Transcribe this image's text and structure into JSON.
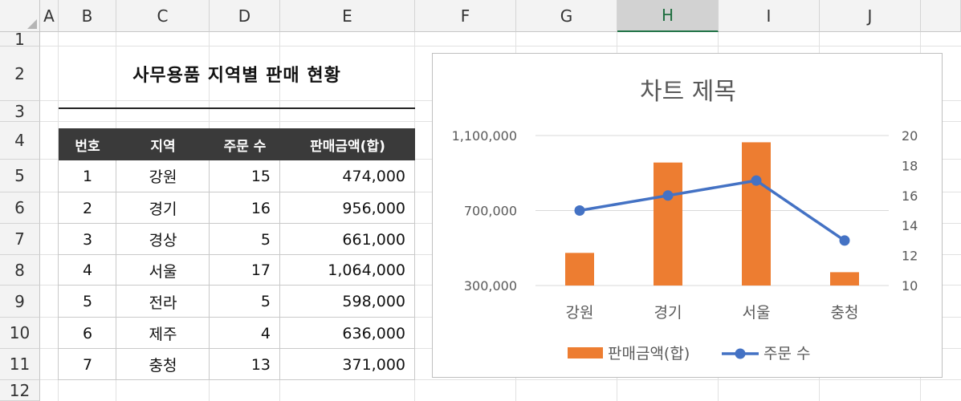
{
  "columns": [
    "A",
    "B",
    "C",
    "D",
    "E",
    "F",
    "G",
    "H",
    "I",
    "J"
  ],
  "rows": [
    "1",
    "2",
    "3",
    "4",
    "5",
    "6",
    "7",
    "8",
    "9",
    "10",
    "11",
    "12"
  ],
  "selected_column": "H",
  "table": {
    "title": "사무용품 지역별 판매 현황",
    "headers": [
      "번호",
      "지역",
      "주문 수",
      "판매금액(합)"
    ],
    "rows": [
      [
        "1",
        "강원",
        "15",
        "474,000"
      ],
      [
        "2",
        "경기",
        "16",
        "956,000"
      ],
      [
        "3",
        "경상",
        "5",
        "661,000"
      ],
      [
        "4",
        "서울",
        "17",
        "1,064,000"
      ],
      [
        "5",
        "전라",
        "5",
        "598,000"
      ],
      [
        "6",
        "제주",
        "4",
        "636,000"
      ],
      [
        "7",
        "충청",
        "13",
        "371,000"
      ]
    ]
  },
  "colors": {
    "bar": "#ED7D31",
    "line": "#4472C4",
    "header_bg": "#3A3A3A"
  },
  "chart_data": {
    "type": "bar",
    "title": "차트 제목",
    "categories": [
      "강원",
      "경기",
      "서울",
      "충청"
    ],
    "series": [
      {
        "name": "판매금액(합)",
        "kind": "bar",
        "axis": "left",
        "values": [
          474000,
          956000,
          1064000,
          371000
        ]
      },
      {
        "name": "주문 수",
        "kind": "line",
        "axis": "right",
        "values": [
          15,
          16,
          17,
          13
        ]
      }
    ],
    "left_axis": {
      "min": 300000,
      "max": 1100000,
      "ticks": [
        300000,
        700000,
        1100000
      ],
      "tick_labels": [
        "300,000",
        "700,000",
        "1,100,000"
      ]
    },
    "right_axis": {
      "min": 10,
      "max": 20,
      "ticks": [
        10,
        12,
        14,
        16,
        18,
        20
      ],
      "tick_labels": [
        "10",
        "12",
        "14",
        "16",
        "18",
        "20"
      ]
    },
    "grid": true,
    "legend": "bottom"
  }
}
